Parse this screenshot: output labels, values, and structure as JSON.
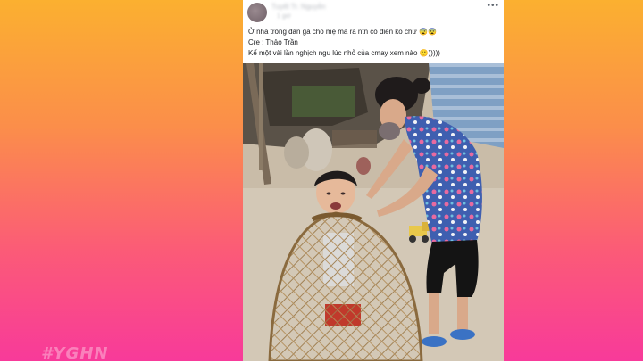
{
  "post": {
    "author": "Tuyết Tr. Nguyễn",
    "timestamp": "1 giờ",
    "more_label": "•••",
    "caption_lines": [
      "Ở nhà trông đàn gà cho mẹ mà ra ntn có điên ko chứ 😨😨",
      "Cre : Thảo Trần",
      "Kể một vài lần nghịch ngu lúc nhỏ của cmay xem nào 🙂)))))"
    ]
  },
  "watermark": "#YGHN",
  "colors": {
    "background_top": "#fbb030",
    "background_bottom": "#f83a9a",
    "card": "#ffffff",
    "text": "#1c1e21"
  },
  "icons": [
    "more-options-icon"
  ]
}
